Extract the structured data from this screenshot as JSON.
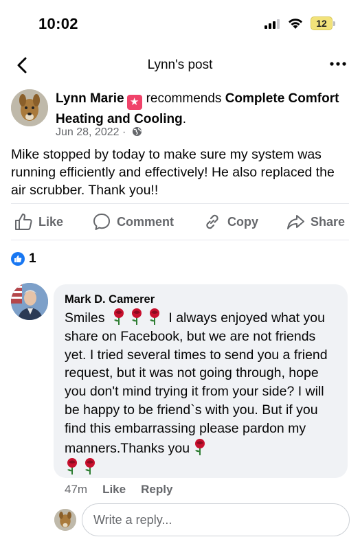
{
  "status_bar": {
    "time": "10:02",
    "battery": "12"
  },
  "nav": {
    "title": "Lynn's post"
  },
  "post": {
    "author": "Lynn Marie",
    "recommends_text": "recommends",
    "business": "Complete Comfort Heating and Cooling",
    "period": ".",
    "date": "Jun 28, 2022 ·",
    "body": "Mike stopped by today to make sure my system was running efficiently and effectively!  He also replaced the air scrubber.  Thank you!!"
  },
  "actions": {
    "like": "Like",
    "comment": "Comment",
    "copy": "Copy",
    "share": "Share"
  },
  "reactions": {
    "count": "1"
  },
  "comment": {
    "author": "Mark D. Camerer",
    "text_start": "Smiles",
    "text_main": "I always enjoyed what you share on Facebook, but we are not friends yet. I tried several times to send you a friend request, but it was not going through, hope you don't mind trying it from your side? I will be happy to be friend`s with you. But if you find this embarrassing please pardon my manners.Thanks you",
    "time": "47m",
    "like": "Like",
    "reply": "Reply"
  },
  "reply_box": {
    "placeholder": "Write a reply..."
  },
  "colors": {
    "accent": "#1877f2",
    "muted": "#65676b",
    "bubble": "#f0f2f5",
    "rose": "#c8102e"
  }
}
